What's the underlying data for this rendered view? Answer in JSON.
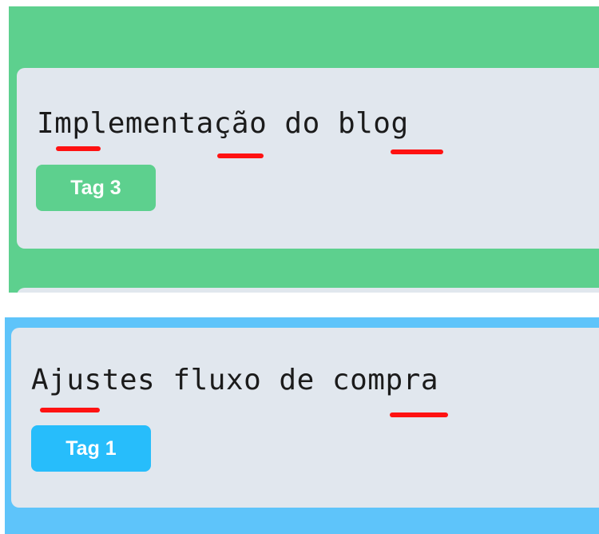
{
  "cards": [
    {
      "title": "Implementação do blog",
      "tag": "Tag 3",
      "column_color": "#5dd08e",
      "tag_color": "#5dd08e"
    },
    {
      "title": "Ajustes fluxo de compra",
      "tag": "Tag 1",
      "column_color": "#5ec4fa",
      "tag_color": "#27bdfb"
    }
  ],
  "card_background": "#e1e7ee",
  "annotation_color": "#ff1212"
}
